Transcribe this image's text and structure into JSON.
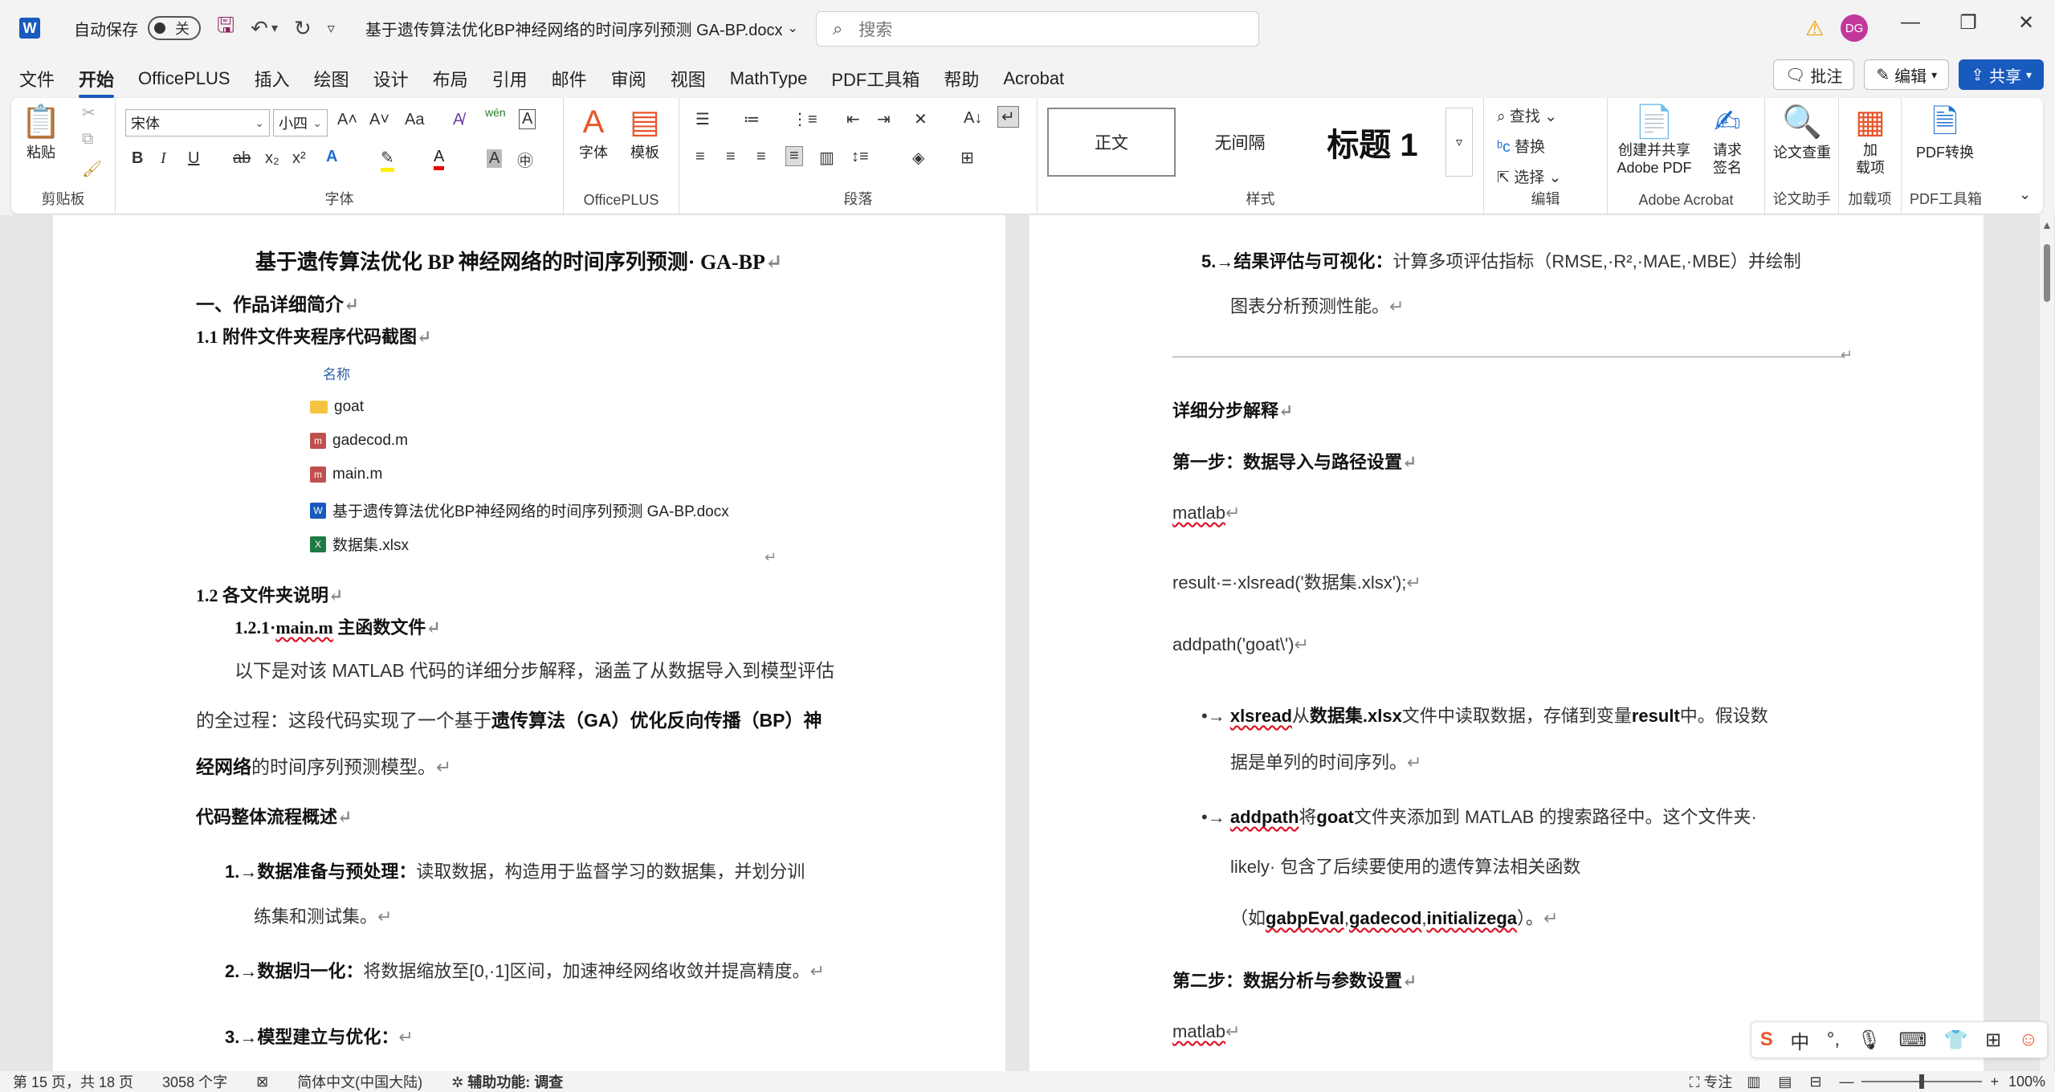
{
  "titlebar": {
    "app_icon": "word-logo",
    "autosave_label": "自动保存",
    "autosave_state": "关",
    "doc_title": "基于遗传算法优化BP神经网络的时间序列预测 GA-BP.docx",
    "search_placeholder": "搜索",
    "user_initials": "DG"
  },
  "tabs": [
    "文件",
    "开始",
    "OfficePLUS",
    "插入",
    "绘图",
    "设计",
    "布局",
    "引用",
    "邮件",
    "审阅",
    "视图",
    "MathType",
    "PDF工具箱",
    "帮助",
    "Acrobat"
  ],
  "right_buttons": {
    "comment": "批注",
    "edit": "编辑",
    "share": "共享"
  },
  "ribbon": {
    "clipboard": {
      "paste": "粘贴",
      "label": "剪贴板"
    },
    "font": {
      "name": "宋体",
      "size": "小四",
      "label": "字体"
    },
    "officeplus": {
      "font_btn": "字体",
      "template_btn": "模板",
      "label": "OfficePLUS"
    },
    "paragraph": {
      "label": "段落"
    },
    "styles": {
      "normal": "正文",
      "no_spacing": "无间隔",
      "heading1": "标题 1",
      "label": "样式"
    },
    "editing": {
      "find": "查找",
      "replace": "替换",
      "select": "选择",
      "label": "编辑"
    },
    "acrobat": {
      "create_share_1": "创建并共享",
      "create_share_2": "Adobe PDF",
      "request_1": "请求",
      "request_2": "签名",
      "label": "Adobe Acrobat"
    },
    "paper": {
      "check": "论文查重",
      "label": "论文助手"
    },
    "addins": {
      "btn_1": "加",
      "btn_2": "载项",
      "label": "加载项"
    },
    "pdf": {
      "convert": "PDF转换",
      "label": "PDF工具箱"
    }
  },
  "page1": {
    "title": "基于遗传算法优化 BP 神经网络的时间序列预测· GA-BP",
    "h1": "一、作品详细简介",
    "h11": "1.1 附件文件夹程序代码截图",
    "files_header": "名称",
    "files": [
      {
        "name": "goat",
        "icon": "folder-icon"
      },
      {
        "name": "gadecod.m",
        "icon": "matlab-file-icon"
      },
      {
        "name": "main.m",
        "icon": "matlab-file-icon"
      },
      {
        "name": "基于遗传算法优化BP神经网络的时间序列预测 GA-BP.docx",
        "icon": "word-file-icon"
      },
      {
        "name": "数据集.xlsx",
        "icon": "excel-file-icon"
      }
    ],
    "h12": "1.2 各文件夹说明",
    "h121_num": "1.2.1·",
    "h121_file": "main.m",
    "h121_text": " 主函数文件",
    "para1_line1": "以下是对该 MATLAB 代码的详细分步解释，涵盖了从数据导入到模型评估",
    "para1_line2_a": "的全过程：这段代码实现了一个基于",
    "para1_line2_b": "遗传算法（GA）优化反向传播（BP）神",
    "para1_line3_a": "经网络",
    "para1_line3_b": "的时间序列预测模型。",
    "overview": "代码整体流程概述",
    "step1_head": "1.→数据准备与预处理：",
    "step1_text": "读取数据，构造用于监督学习的数据集，并划分训",
    "step1_line2": "练集和测试集。",
    "step2_head": "2.→数据归一化：",
    "step2_text": "将数据缩放至[0,·1]区间，加速神经网络收敛并提高精度。",
    "step3_head": "3.→模型建立与优化："
  },
  "page2": {
    "step5_head": "5.→结果评估与可视化：",
    "step5_text": "计算多项评估指标（RMSE,·R²,·MAE,·MBE）并绘制",
    "step5_line2": "图表分析预测性能。",
    "detail": "详细分步解释",
    "step_one": "第一步：数据导入与路径设置",
    "matlab1": "matlab",
    "code1": "result·=·xlsread('数据集.xlsx');",
    "code2": "addpath('goat\\')",
    "bullet1_a": "xlsread",
    "bullet1_b": "从",
    "bullet1_c": "数据集.xlsx",
    "bullet1_d": "文件中读取数据，存储到变量",
    "bullet1_e": "result",
    "bullet1_f": "中。假设数",
    "bullet1_line2": "据是单列的时间序列。",
    "bullet2_a": "addpath",
    "bullet2_b": "将",
    "bullet2_c": "goat",
    "bullet2_d": "文件夹添加到 MATLAB 的搜索路径中。这个文件夹·",
    "bullet2_line2": "likely· 包含了后续要使用的遗传算法相关函数",
    "bullet2_line3_a": "（如",
    "bullet2_line3_b": "gabpEval",
    "bullet2_line3_c": "gadecod",
    "bullet2_line3_d": "initializega",
    "bullet2_line3_e": "）。",
    "step_two": "第二步：数据分析与参数设置",
    "matlab2": "matlab"
  },
  "status": {
    "page": "第 15 页，共 18 页",
    "words": "3058 个字",
    "language": "简体中文(中国大陆)",
    "accessibility": "辅助功能: 调查",
    "focus": "专注",
    "zoom": "100%"
  },
  "ime": {
    "lang": "中"
  }
}
